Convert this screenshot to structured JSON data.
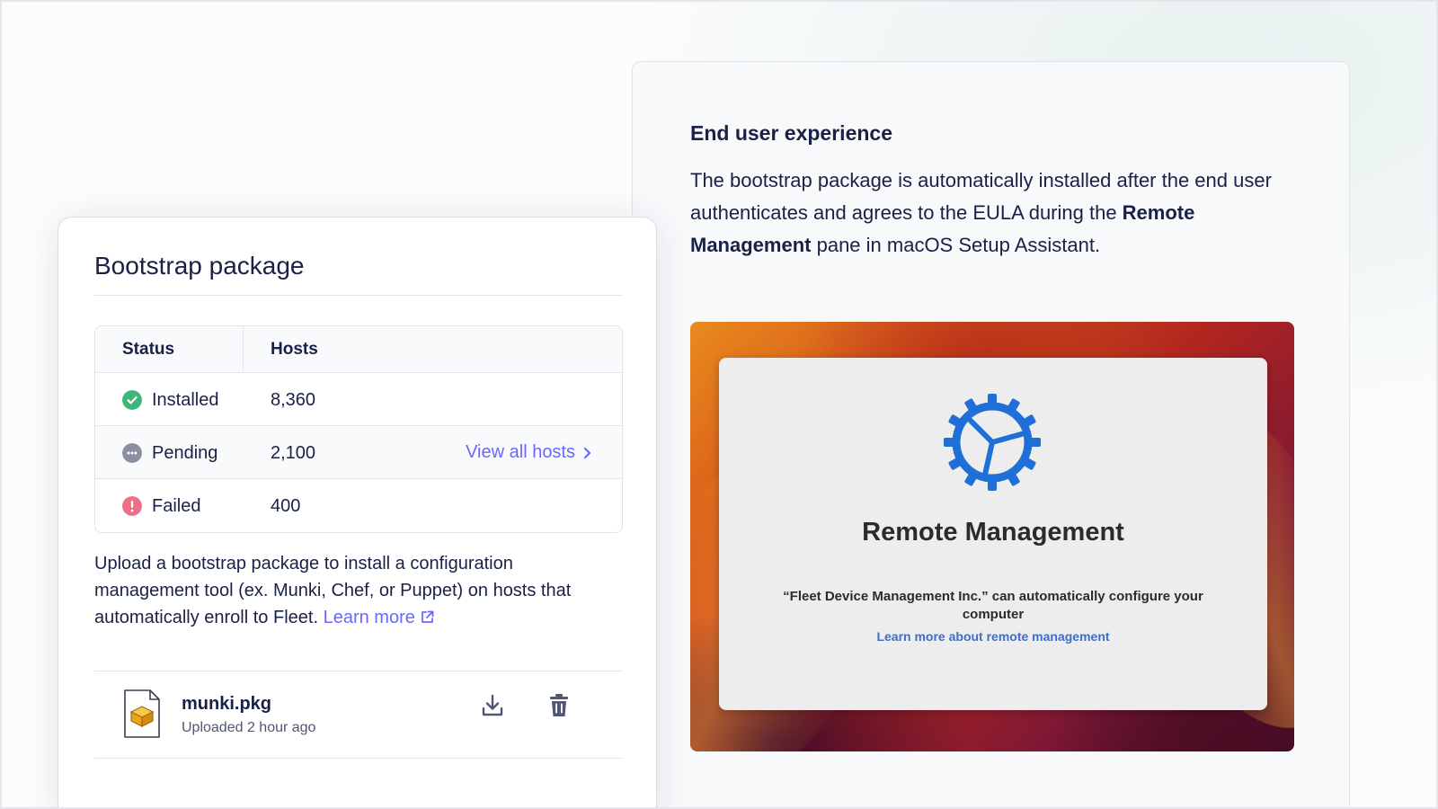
{
  "end_user_experience": {
    "title": "End user experience",
    "body_part1": "The bootstrap package is automatically installed after the end user authenticates and agrees to the EULA during the ",
    "body_bold": "Remote Management",
    "body_part2": " pane in macOS Setup Assistant."
  },
  "remote_management_dialog": {
    "title": "Remote Management",
    "message": "“Fleet Device Management Inc.” can automatically configure your computer",
    "link": "Learn more about remote management",
    "icon": "gear-icon"
  },
  "bootstrap_card": {
    "title": "Bootstrap package",
    "table": {
      "headers": [
        "Status",
        "Hosts"
      ],
      "rows": [
        {
          "status": "Installed",
          "hosts": "8,360",
          "icon": "check-circle-icon",
          "color": "#3db67b"
        },
        {
          "status": "Pending",
          "hosts": "2,100",
          "icon": "pending-circle-icon",
          "color": "#8b8fa2"
        },
        {
          "status": "Failed",
          "hosts": "400",
          "icon": "error-circle-icon",
          "color": "#ed6e85"
        }
      ],
      "view_all_label": "View all hosts"
    },
    "description": "Upload a bootstrap package to install a configuration management tool (ex. Munki, Chef, or Puppet) on hosts that automatically enroll to Fleet.",
    "learn_more_label": "Learn more",
    "file": {
      "name": "munki.pkg",
      "meta": "Uploaded 2 hour ago",
      "icon": "package-file-icon"
    }
  },
  "colors": {
    "text": "#192147",
    "link": "#6a67fe",
    "dialog_link": "#3f6fc4",
    "gear": "#1f6fd6"
  }
}
